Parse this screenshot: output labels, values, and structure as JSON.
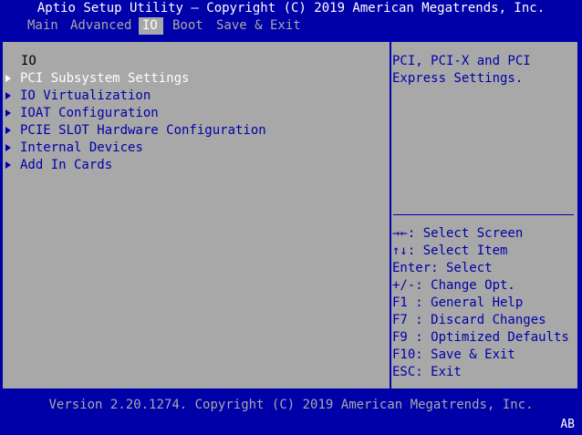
{
  "window": {
    "title": "Aptio Setup Utility – Copyright (C) 2019 American Megatrends, Inc."
  },
  "menu": {
    "tabs": [
      {
        "label": "Main"
      },
      {
        "label": "Advanced"
      },
      {
        "label": "IO"
      },
      {
        "label": "Boot"
      },
      {
        "label": "Save & Exit"
      }
    ],
    "active": "IO"
  },
  "left_panel": {
    "title": "IO",
    "items": [
      {
        "label": "PCI Subsystem Settings"
      },
      {
        "label": "IO Virtualization"
      },
      {
        "label": "IOAT Configuration"
      },
      {
        "label": "PCIE SLOT Hardware Configuration"
      },
      {
        "label": "Internal Devices"
      },
      {
        "label": "Add In Cards"
      }
    ],
    "selected_index": 0
  },
  "help": {
    "lines": [
      "PCI, PCI-X and PCI",
      "Express Settings."
    ]
  },
  "keys": [
    "→←: Select Screen",
    "↑↓: Select Item",
    "Enter: Select",
    "+/-: Change Opt.",
    "F1 : General Help",
    "F7 : Discard Changes",
    "F9 : Optimized Defaults",
    "F10: Save & Exit",
    "ESC: Exit"
  ],
  "footer": {
    "version": "Version 2.20.1274. Copyright (C) 2019 American Megatrends, Inc.",
    "badge": "AB"
  },
  "colors": {
    "background": "#0000a8",
    "panel": "#a8a8a8",
    "highlight": "#ffffff",
    "text": "#0000a8"
  }
}
